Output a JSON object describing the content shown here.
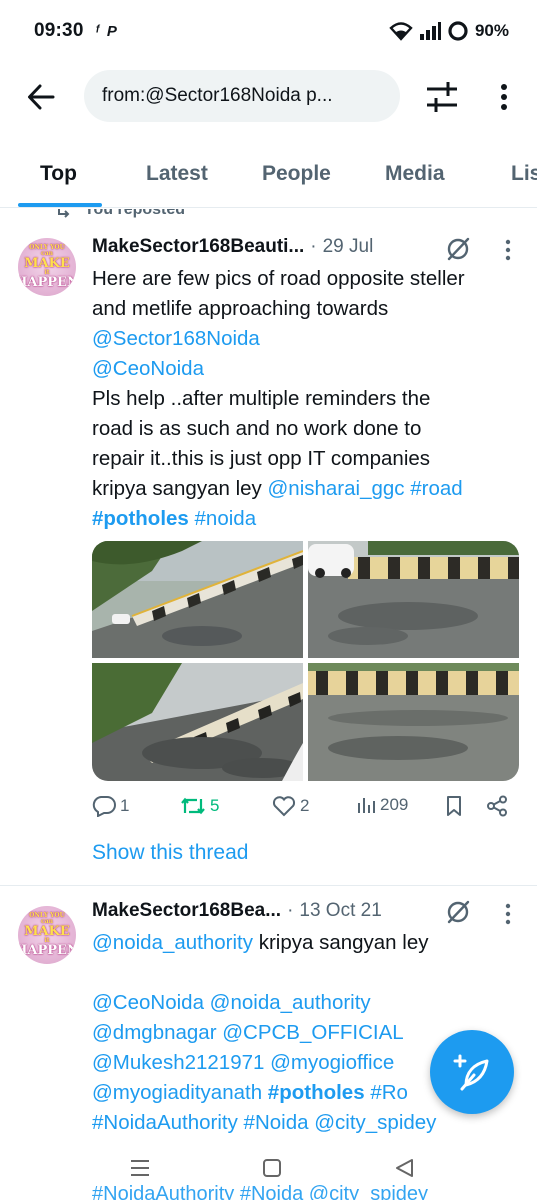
{
  "status_bar": {
    "time": "09:30",
    "app_icons": [
      "ᶠ",
      "P"
    ],
    "battery": "90%"
  },
  "header": {
    "search_value": "from:@Sector168Noida p..."
  },
  "tabs": [
    {
      "label": "Top",
      "active": true
    },
    {
      "label": "Latest",
      "active": false
    },
    {
      "label": "People",
      "active": false
    },
    {
      "label": "Media",
      "active": false
    },
    {
      "label": "Lis",
      "active": false
    }
  ],
  "feed": {
    "reposted_label": "You reposted",
    "tweets": [
      {
        "avatar_text": {
          "top": "ONLY YOU",
          "mid1": "can",
          "mid2": "MAKE",
          "mid3": "it",
          "bottom": "HAPPEN"
        },
        "display_name": "MakeSector168Beauti...",
        "date": "29 Jul",
        "text_lines": [
          "Here are few pics of road opposite steller",
          "and metlife approaching towards",
          "@Sector168Noida",
          "@CeoNoida",
          "Pls help ..after multiple reminders the",
          "road is as such and no work done to",
          "repair it..this is just opp IT companies",
          "kripya sangyan ley ",
          "@nisharai_ggc",
          " ",
          "#road",
          "#potholes",
          " ",
          "#noida"
        ],
        "replies": "1",
        "retweets": "5",
        "likes": "2",
        "views": "209",
        "show_thread": "Show this thread"
      },
      {
        "display_name": "MakeSector168Bea...",
        "date": "13 Oct 21",
        "line1_link": "@noida_authority",
        "line1_text": " kripya sangyan ley",
        "line2": "@CeoNoida @noida_authority",
        "line3": "@dmgbnagar @CPCB_OFFICIAL",
        "line4": "@Mukesh2121971 @myogioffice",
        "line5_a": "@myogiadityanath ",
        "line5_b": "#potholes",
        "line5_c": " #Ro",
        "line6": "#NoidaAuthority #Noida @city_spidey"
      }
    ]
  },
  "navbar_peek": "#NoidaAuthority #Noida @city_spidey",
  "colors": {
    "accent": "#1d9bf0",
    "retweet_active": "#00ba7c",
    "secondary_text": "#536471",
    "search_bg": "#eff3f4"
  }
}
